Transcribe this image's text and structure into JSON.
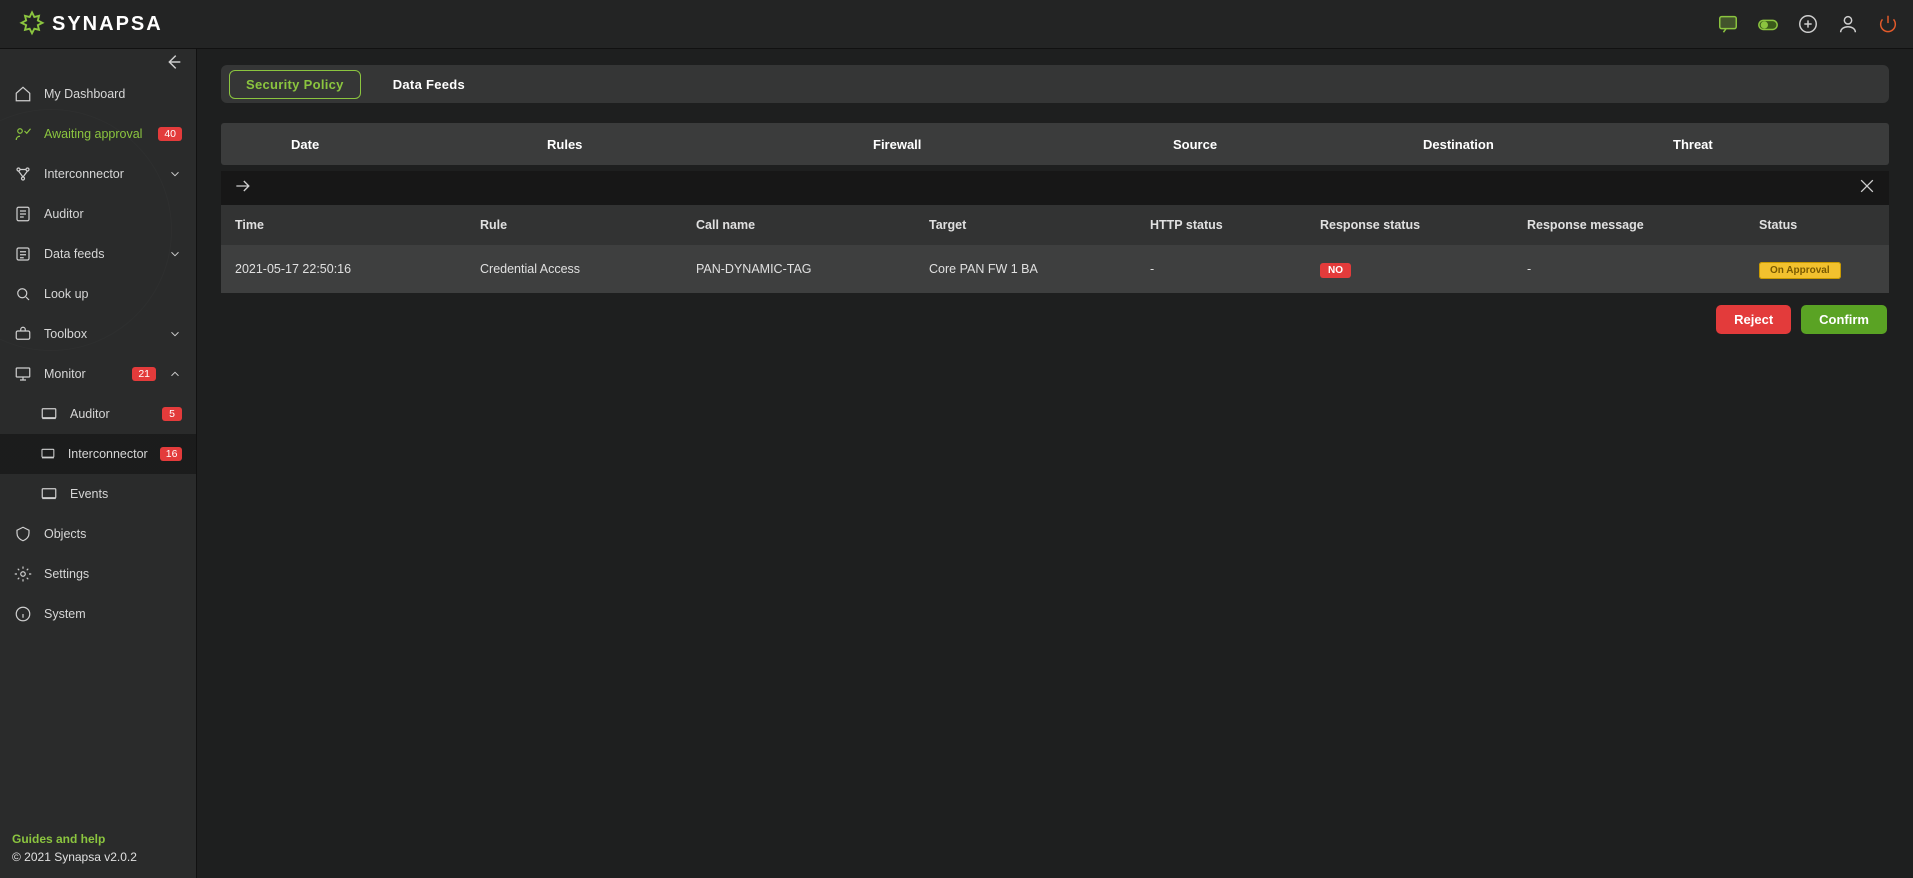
{
  "app": {
    "name": "SYNAPSA"
  },
  "sidebar": {
    "items": [
      {
        "label": "My Dashboard"
      },
      {
        "label": "Awaiting approval",
        "badge": "40"
      },
      {
        "label": "Interconnector"
      },
      {
        "label": "Auditor"
      },
      {
        "label": "Data feeds"
      },
      {
        "label": "Look up"
      },
      {
        "label": "Toolbox"
      },
      {
        "label": "Monitor",
        "badge": "21"
      },
      {
        "label": "Objects"
      },
      {
        "label": "Settings"
      },
      {
        "label": "System"
      }
    ],
    "subnav_monitor": [
      {
        "label": "Auditor",
        "badge": "5"
      },
      {
        "label": "Interconnector",
        "badge": "16"
      },
      {
        "label": "Events"
      }
    ],
    "footer": {
      "guides": "Guides and help",
      "copyright": "© 2021 Synapsa v2.0.2"
    }
  },
  "tabs": [
    {
      "label": "Security Policy",
      "active": true
    },
    {
      "label": "Data Feeds",
      "active": false
    }
  ],
  "filter_columns": {
    "date": "Date",
    "rules": "Rules",
    "firewall": "Firewall",
    "source": "Source",
    "destination": "Destination",
    "threat": "Threat"
  },
  "detail": {
    "headers": {
      "time": "Time",
      "rule": "Rule",
      "call": "Call name",
      "target": "Target",
      "http": "HTTP status",
      "resp": "Response status",
      "msg": "Response message",
      "status": "Status"
    },
    "row": {
      "time": "2021-05-17 22:50:16",
      "rule": "Credential Access",
      "call": "PAN-DYNAMIC-TAG",
      "target": "Core PAN FW 1 BA",
      "http": "-",
      "resp": "NO",
      "msg": "-",
      "status": "On Approval"
    }
  },
  "actions": {
    "reject": "Reject",
    "confirm": "Confirm"
  }
}
